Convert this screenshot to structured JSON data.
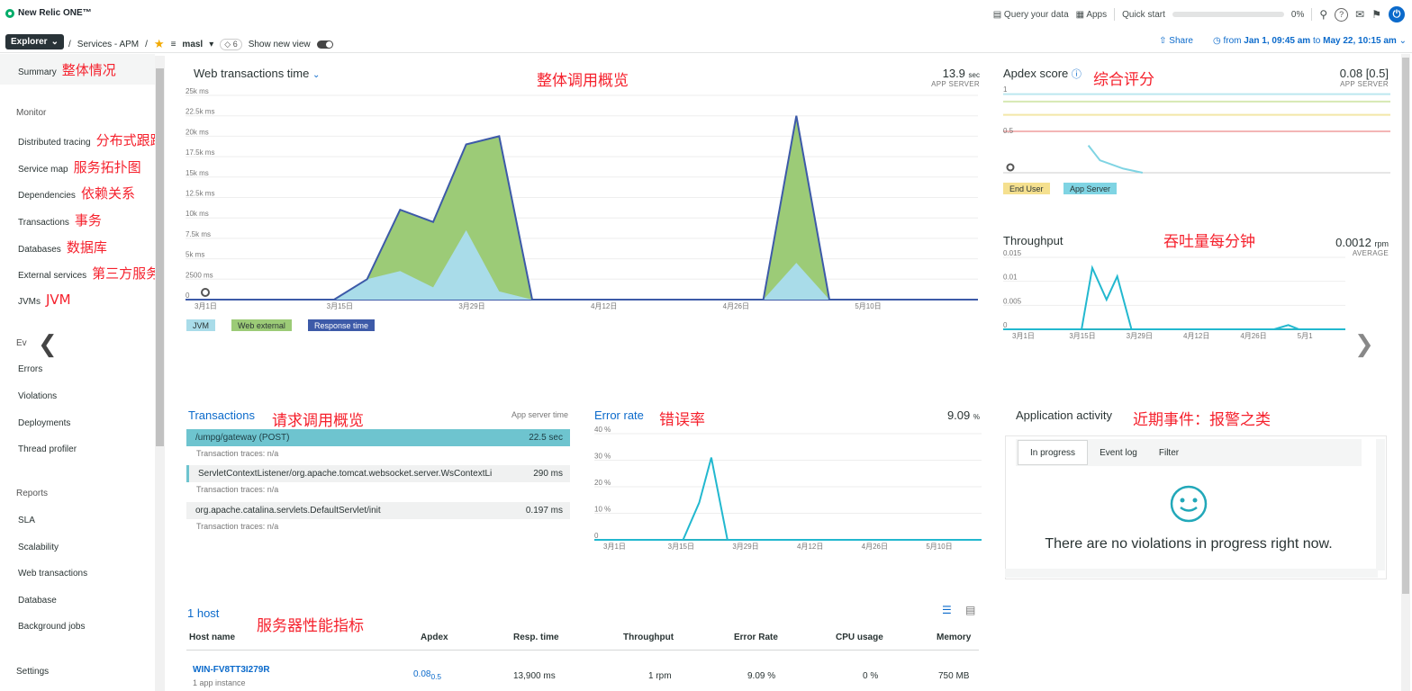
{
  "topbar": {
    "logo": "New Relic ONE™",
    "query": "Query your data",
    "apps": "Apps",
    "quick_start": "Quick start",
    "quick_start_pct": "0%"
  },
  "navbar": {
    "explorer": "Explorer",
    "crumb_services": "Services - APM",
    "entity": "masl",
    "tags": "6",
    "show_new_view": "Show new view",
    "share": "Share",
    "time_from_prefix": "from",
    "time_from": "Jan 1, 09:45 am",
    "time_to_prefix": "to",
    "time_to": "May 22, 10:15 am"
  },
  "sidebar": {
    "summary": "Summary",
    "summary_ann": "整体情况",
    "monitor": "Monitor",
    "items": [
      {
        "label": "Distributed tracing",
        "ann": "分布式跟踪"
      },
      {
        "label": "Service map",
        "ann": "服务拓扑图"
      },
      {
        "label": "Dependencies",
        "ann": "依赖关系"
      },
      {
        "label": "Transactions",
        "ann": "事务"
      },
      {
        "label": "Databases",
        "ann": "数据库"
      },
      {
        "label": "External services",
        "ann": "第三方服务"
      },
      {
        "label": "JVMs",
        "ann": "JVM"
      }
    ],
    "events_heading": "Ev",
    "events": [
      "Errors",
      "Violations",
      "Deployments",
      "Thread profiler"
    ],
    "reports": "Reports",
    "report_items": [
      "SLA",
      "Scalability",
      "Web transactions",
      "Database",
      "Background jobs"
    ],
    "settings": "Settings"
  },
  "web_tx": {
    "title": "Web transactions time",
    "ann": "整体调用概览",
    "value": "13.9",
    "unit": "sec",
    "sub": "APP SERVER",
    "legend": [
      "JVM",
      "Web external",
      "Response time"
    ],
    "colors": {
      "jvm": "#a9dce9",
      "web_external": "#9ccb77",
      "response": "#3d5aa8"
    }
  },
  "apdex": {
    "title": "Apdex score",
    "ann": "综合评分",
    "value": "0.08 [0.5]",
    "sub": "APP SERVER",
    "legend": [
      "End User",
      "App Server"
    ],
    "ticks": [
      "1",
      "0.5",
      "0"
    ]
  },
  "throughput": {
    "title": "Throughput",
    "ann": "吞吐量每分钟",
    "value": "0.0012",
    "unit": "rpm",
    "sub": "AVERAGE"
  },
  "transactions": {
    "title": "Transactions",
    "ann": "请求调用概览",
    "col": "App server time",
    "rows": [
      {
        "name": "/umpg/gateway (POST)",
        "value": "22.5 sec",
        "traces_label": "Transaction traces:",
        "traces": "n/a"
      },
      {
        "name": "ServletContextListener/org.apache.tomcat.websocket.server.WsContextLi",
        "value": "290 ms",
        "traces_label": "Transaction traces:",
        "traces": "n/a"
      },
      {
        "name": "org.apache.catalina.servlets.DefaultServlet/init",
        "value": "0.197 ms",
        "traces_label": "Transaction traces:",
        "traces": "n/a"
      }
    ]
  },
  "error_rate": {
    "title": "Error rate",
    "ann": "错误率",
    "value": "9.09",
    "unit": "%"
  },
  "activity": {
    "title": "Application activity",
    "ann": "近期事件：报警之类",
    "tabs": [
      "In progress",
      "Event log",
      "Filter"
    ],
    "empty": "There are no violations in progress right now."
  },
  "hosts": {
    "title": "1 host",
    "ann": "服务器性能指标",
    "headers": [
      "Host name",
      "Apdex",
      "Resp. time",
      "Throughput",
      "Error Rate",
      "CPU usage",
      "Memory"
    ],
    "row": {
      "name": "WIN-FV8TT3I279R",
      "instances": "1 app instance",
      "apdex": "0.08",
      "apdex_t": "0.5",
      "resp": "13,900 ms",
      "throughput": "1 rpm",
      "error": "9.09 %",
      "cpu": "0 %",
      "memory": "750 MB"
    }
  },
  "chart_data": [
    {
      "type": "area",
      "title": "Web transactions time",
      "x": [
        "3月1日",
        "3月15日",
        "3月29日",
        "4月12日",
        "4月26日",
        "5月10日"
      ],
      "ylabel_ticks": [
        "25k ms",
        "22.5k ms",
        "20k ms",
        "17.5k ms",
        "15k ms",
        "12.5k ms",
        "10k ms",
        "7.5k ms",
        "5k ms",
        "2500 ms",
        "0"
      ],
      "ylim": [
        0,
        25000
      ],
      "series": [
        {
          "name": "JVM",
          "points": [
            [
              0,
              0
            ],
            [
              9,
              0
            ],
            [
              11,
              2500
            ],
            [
              13,
              3500
            ],
            [
              15,
              1500
            ],
            [
              17,
              8500
            ],
            [
              19,
              1000
            ],
            [
              21,
              0
            ],
            [
              35,
              0
            ],
            [
              37,
              4500
            ],
            [
              39,
              0
            ],
            [
              48,
              0
            ]
          ]
        },
        {
          "name": "Web external",
          "points": [
            [
              0,
              0
            ],
            [
              9,
              0
            ],
            [
              11,
              2500
            ],
            [
              13,
              11000
            ],
            [
              15,
              9500
            ],
            [
              17,
              19000
            ],
            [
              19,
              20000
            ],
            [
              21,
              0
            ],
            [
              35,
              0
            ],
            [
              37,
              22500
            ],
            [
              39,
              0
            ],
            [
              48,
              0
            ]
          ]
        },
        {
          "name": "Response time",
          "points": [
            [
              0,
              0
            ],
            [
              9,
              0
            ],
            [
              11,
              2500
            ],
            [
              13,
              11000
            ],
            [
              15,
              9500
            ],
            [
              17,
              19000
            ],
            [
              19,
              20000
            ],
            [
              21,
              0
            ],
            [
              35,
              0
            ],
            [
              37,
              22500
            ],
            [
              39,
              0
            ],
            [
              48,
              0
            ]
          ]
        }
      ]
    },
    {
      "type": "line",
      "title": "Apdex score",
      "ylim": [
        0,
        1
      ],
      "series": [
        {
          "name": "App Server",
          "points": [
            [
              0.22,
              0.33
            ],
            [
              0.25,
              0.15
            ],
            [
              0.31,
              0.05
            ],
            [
              0.36,
              0
            ]
          ]
        }
      ]
    },
    {
      "type": "line",
      "title": "Throughput",
      "x": [
        "3月1日",
        "3月15日",
        "3月29日",
        "4月12日",
        "4月26日",
        "5月1"
      ],
      "y_ticks": [
        "0.015",
        "0.01",
        "0.005",
        "0"
      ],
      "ylim": [
        0,
        0.017
      ],
      "series": [
        {
          "name": "Throughput",
          "points": [
            [
              0,
              0
            ],
            [
              11,
              0
            ],
            [
              12.5,
              0.0145
            ],
            [
              14.5,
              0.007
            ],
            [
              16,
              0.0125
            ],
            [
              18,
              0
            ],
            [
              38,
              0
            ],
            [
              40,
              0.001
            ],
            [
              41.5,
              0
            ],
            [
              48,
              0
            ]
          ]
        }
      ]
    },
    {
      "type": "line",
      "title": "Error rate",
      "x": [
        "3月1日",
        "3月15日",
        "3月29日",
        "4月12日",
        "4月26日",
        "5月10日"
      ],
      "y_ticks": [
        "40 %",
        "30 %",
        "20 %",
        "10 %",
        "0"
      ],
      "ylim": [
        0,
        40
      ],
      "series": [
        {
          "name": "Error rate",
          "points": [
            [
              0,
              0
            ],
            [
              11,
              0
            ],
            [
              13,
              14
            ],
            [
              14.5,
              31
            ],
            [
              16.5,
              0
            ],
            [
              48,
              0
            ]
          ]
        }
      ]
    }
  ]
}
